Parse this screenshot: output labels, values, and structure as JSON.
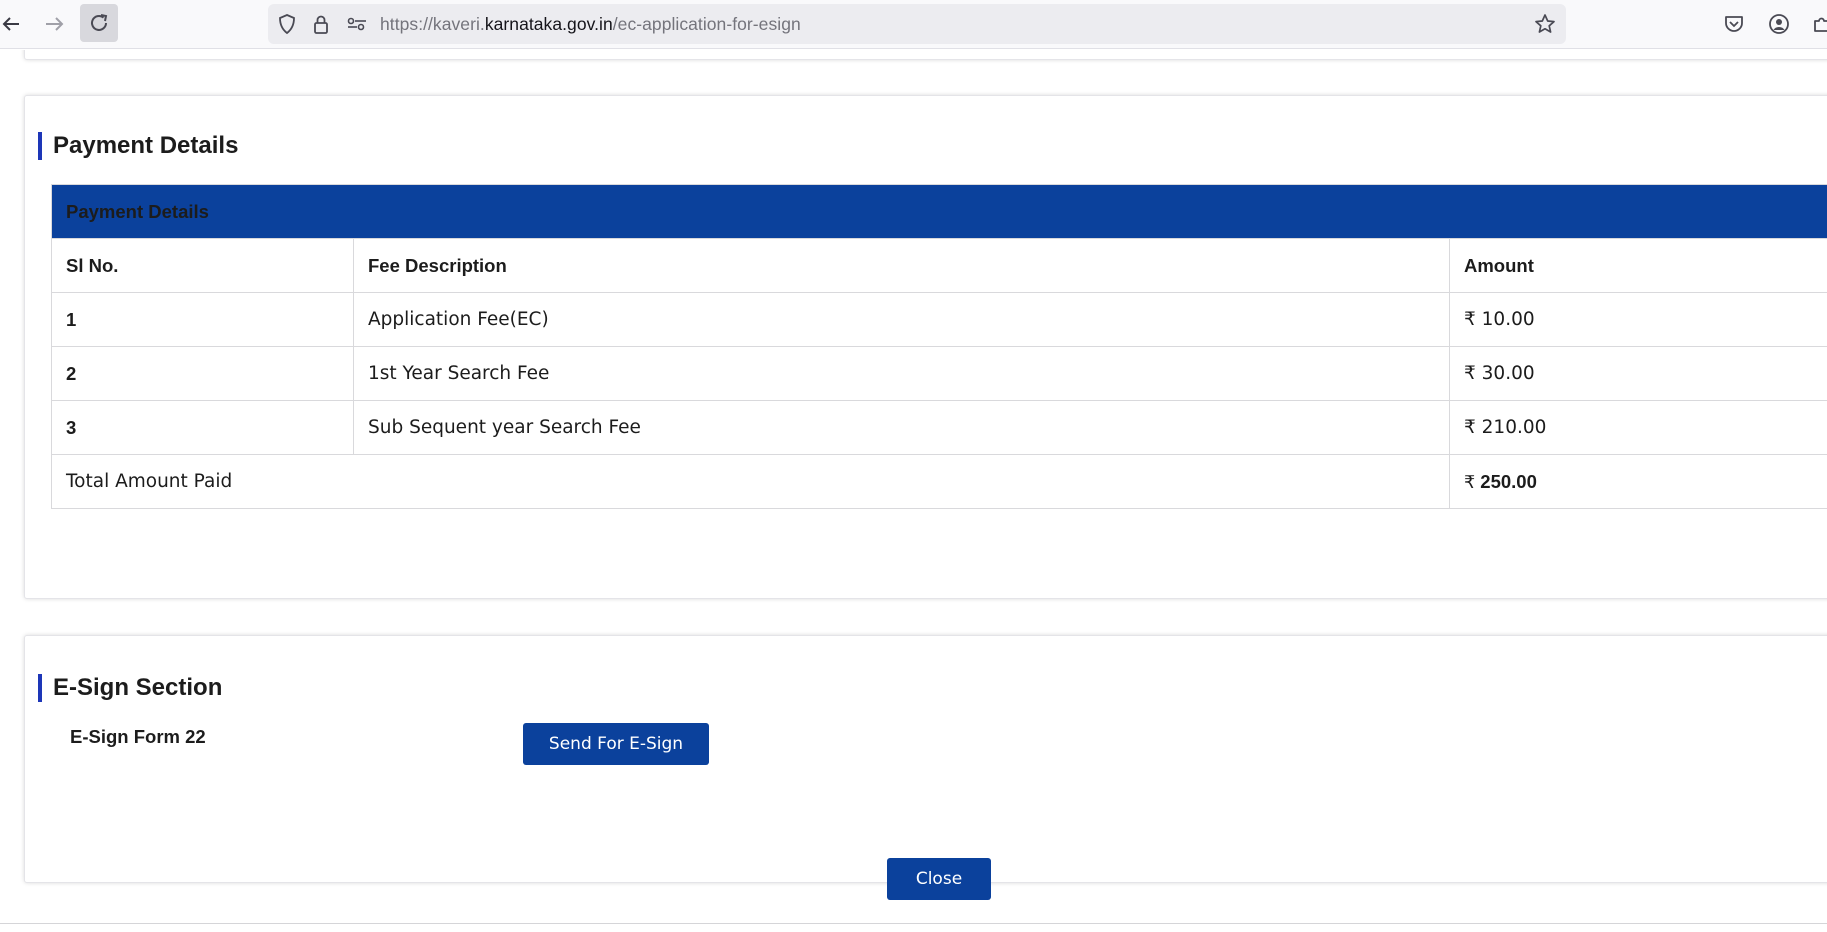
{
  "browser": {
    "url_prefix": "https://kaveri.",
    "url_domain": "karnataka.gov.in",
    "url_path": "/ec-application-for-esign"
  },
  "payment_section": {
    "title": "Payment Details",
    "table_title": "Payment Details",
    "columns": [
      "Sl No.",
      "Fee Description",
      "Amount"
    ],
    "rows": [
      {
        "sl": "1",
        "description": "Application Fee(EC)",
        "amount": "₹ 10.00"
      },
      {
        "sl": "2",
        "description": "1st Year Search Fee",
        "amount": "₹ 30.00"
      },
      {
        "sl": "3",
        "description": "Sub Sequent year Search Fee",
        "amount": "₹ 210.00"
      }
    ],
    "total_label": "Total Amount Paid",
    "total_currency": "₹",
    "total_amount": "250.00"
  },
  "esign_section": {
    "title": "E-Sign Section",
    "form_label": "E-Sign Form 22",
    "send_button": "Send For E-Sign"
  },
  "footer": {
    "close_button": "Close"
  },
  "colors": {
    "primary": "#0b419c",
    "section_bar": "#1d36b8"
  }
}
